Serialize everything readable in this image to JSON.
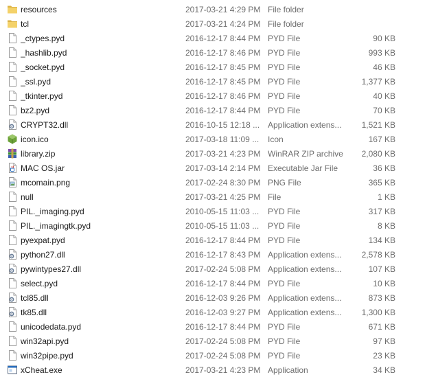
{
  "files": [
    {
      "name": "resources",
      "date": "2017-03-21 4:29 PM",
      "type": "File folder",
      "size": "",
      "icon": "folder-icon"
    },
    {
      "name": "tcl",
      "date": "2017-03-21 4:24 PM",
      "type": "File folder",
      "size": "",
      "icon": "folder-icon"
    },
    {
      "name": "_ctypes.pyd",
      "date": "2016-12-17 8:44 PM",
      "type": "PYD File",
      "size": "90 KB",
      "icon": "file-icon"
    },
    {
      "name": "_hashlib.pyd",
      "date": "2016-12-17 8:46 PM",
      "type": "PYD File",
      "size": "993 KB",
      "icon": "file-icon"
    },
    {
      "name": "_socket.pyd",
      "date": "2016-12-17 8:45 PM",
      "type": "PYD File",
      "size": "46 KB",
      "icon": "file-icon"
    },
    {
      "name": "_ssl.pyd",
      "date": "2016-12-17 8:45 PM",
      "type": "PYD File",
      "size": "1,377 KB",
      "icon": "file-icon"
    },
    {
      "name": "_tkinter.pyd",
      "date": "2016-12-17 8:46 PM",
      "type": "PYD File",
      "size": "40 KB",
      "icon": "file-icon"
    },
    {
      "name": "bz2.pyd",
      "date": "2016-12-17 8:44 PM",
      "type": "PYD File",
      "size": "70 KB",
      "icon": "file-icon"
    },
    {
      "name": "CRYPT32.dll",
      "date": "2016-10-15 12:18 ...",
      "type": "Application extens...",
      "size": "1,521 KB",
      "icon": "dll-icon"
    },
    {
      "name": "icon.ico",
      "date": "2017-03-18 11:09 ...",
      "type": "Icon",
      "size": "167 KB",
      "icon": "ico-icon"
    },
    {
      "name": "library.zip",
      "date": "2017-03-21 4:23 PM",
      "type": "WinRAR ZIP archive",
      "size": "2,080 KB",
      "icon": "zip-icon"
    },
    {
      "name": "MAC OS.jar",
      "date": "2017-03-14 2:14 PM",
      "type": "Executable Jar File",
      "size": "36 KB",
      "icon": "jar-icon"
    },
    {
      "name": "mcomain.png",
      "date": "2017-02-24 8:30 PM",
      "type": "PNG File",
      "size": "365 KB",
      "icon": "image-file-icon"
    },
    {
      "name": "null",
      "date": "2017-03-21 4:25 PM",
      "type": "File",
      "size": "1 KB",
      "icon": "file-icon"
    },
    {
      "name": "PIL._imaging.pyd",
      "date": "2010-05-15 11:03 ...",
      "type": "PYD File",
      "size": "317 KB",
      "icon": "file-icon"
    },
    {
      "name": "PIL._imagingtk.pyd",
      "date": "2010-05-15 11:03 ...",
      "type": "PYD File",
      "size": "8 KB",
      "icon": "file-icon"
    },
    {
      "name": "pyexpat.pyd",
      "date": "2016-12-17 8:44 PM",
      "type": "PYD File",
      "size": "134 KB",
      "icon": "file-icon"
    },
    {
      "name": "python27.dll",
      "date": "2016-12-17 8:43 PM",
      "type": "Application extens...",
      "size": "2,578 KB",
      "icon": "dll-icon"
    },
    {
      "name": "pywintypes27.dll",
      "date": "2017-02-24 5:08 PM",
      "type": "Application extens...",
      "size": "107 KB",
      "icon": "dll-icon"
    },
    {
      "name": "select.pyd",
      "date": "2016-12-17 8:44 PM",
      "type": "PYD File",
      "size": "10 KB",
      "icon": "file-icon"
    },
    {
      "name": "tcl85.dll",
      "date": "2016-12-03 9:26 PM",
      "type": "Application extens...",
      "size": "873 KB",
      "icon": "dll-icon"
    },
    {
      "name": "tk85.dll",
      "date": "2016-12-03 9:27 PM",
      "type": "Application extens...",
      "size": "1,300 KB",
      "icon": "dll-icon"
    },
    {
      "name": "unicodedata.pyd",
      "date": "2016-12-17 8:44 PM",
      "type": "PYD File",
      "size": "671 KB",
      "icon": "file-icon"
    },
    {
      "name": "win32api.pyd",
      "date": "2017-02-24 5:08 PM",
      "type": "PYD File",
      "size": "97 KB",
      "icon": "file-icon"
    },
    {
      "name": "win32pipe.pyd",
      "date": "2017-02-24 5:08 PM",
      "type": "PYD File",
      "size": "23 KB",
      "icon": "file-icon"
    },
    {
      "name": "xCheat.exe",
      "date": "2017-03-21 4:23 PM",
      "type": "Application",
      "size": "34 KB",
      "icon": "exe-icon"
    }
  ],
  "colors": {
    "folder": "#f4d26a",
    "folder_dark": "#dcb346",
    "file_border": "#9a9a9a",
    "gear": "#6b7f99",
    "ico_green": "#6da23a",
    "zip_purple": "#7b4aa8",
    "jar_red": "#d2453b",
    "exe_blue": "#2a6ebd",
    "name_text": "#1a1a1a",
    "meta_text": "#6d6d6d"
  }
}
